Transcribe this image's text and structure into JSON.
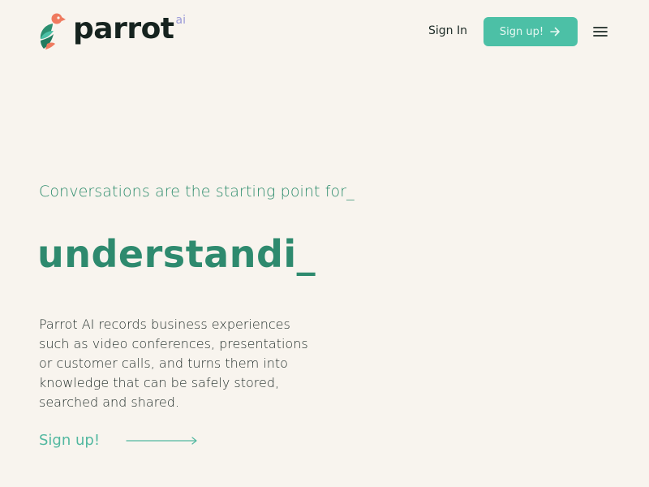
{
  "header": {
    "logo_text": "parrot",
    "logo_badge": "ai",
    "sign_in_label": "Sign In",
    "signup_label": "Sign up!",
    "menu_icon": "hamburger-menu-icon"
  },
  "hero": {
    "tagline": "Conversations are the starting point for_",
    "rotating_word": "understandi_",
    "description": "Parrot AI records business experiences such as video conferences, presentations or customer calls, and turns them into knowledge that can be safely stored, searched and shared.",
    "cta_label": "Sign up!"
  },
  "colors": {
    "background": "#f8f4ee",
    "accent": "#4cc0a6",
    "heading_green": "#2e8a6e",
    "text_dark": "#1e2a27",
    "logo_badge": "#9b9bd8",
    "logo_coral": "#ef7a5f"
  }
}
